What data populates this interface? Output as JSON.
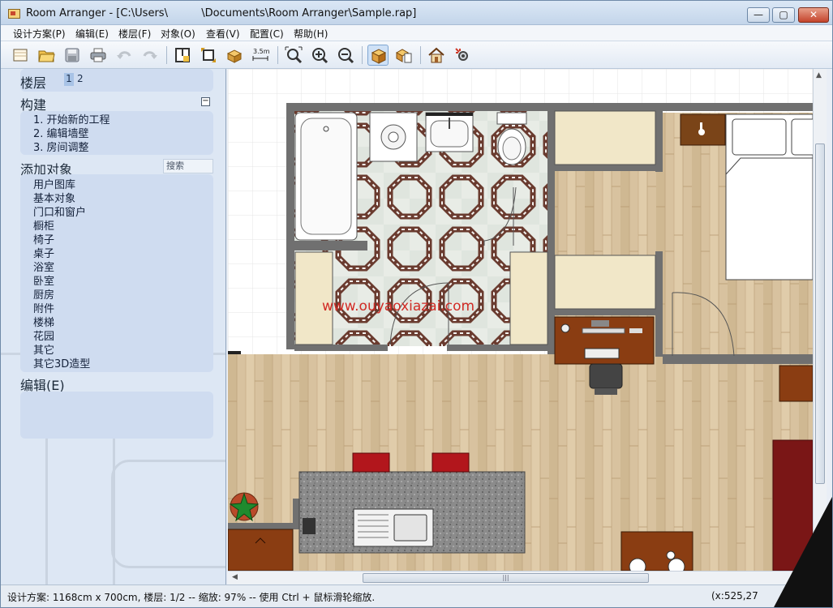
{
  "window": {
    "title": "Room Arranger - [C:\\Users\\          \\Documents\\Room Arranger\\Sample.rap]",
    "controls": {
      "minimize": "—",
      "maximize": "▢",
      "close": "✕"
    }
  },
  "menu": [
    "设计方案(P)",
    "编辑(E)",
    "楼层(F)",
    "对象(O)",
    "查看(V)",
    "配置(C)",
    "帮助(H)"
  ],
  "toolbar": {
    "icons": [
      "new-icon",
      "open-icon",
      "save-icon",
      "print-icon",
      "undo-icon",
      "redo-icon",
      "edit-walls-icon",
      "room-size-icon",
      "objects-icon",
      "measure-icon",
      "zoom-fit-icon",
      "zoom-in-icon",
      "zoom-out-icon",
      "3d-box-icon",
      "3d-view-icon",
      "house-icon",
      "settings-icon"
    ],
    "measure_label": "3.5m"
  },
  "sidebar": {
    "floors": {
      "label": "楼层",
      "items": [
        "1",
        "2"
      ],
      "selected": "1"
    },
    "construct": {
      "label": "构建",
      "collapse": "−",
      "steps": [
        "1. 开始新的工程",
        "2. 编辑墙壁",
        "3. 房间调整"
      ]
    },
    "add_objects": {
      "label": "添加对象",
      "search": "搜索",
      "categories": [
        "用户图库",
        "基本对象",
        "门口和窗户",
        "橱柜",
        "椅子",
        "桌子",
        "浴室",
        "卧室",
        "厨房",
        "附件",
        "楼梯",
        "花园",
        "其它",
        "其它3D造型"
      ]
    },
    "edit": {
      "label": "编辑(E)"
    }
  },
  "canvas": {
    "watermark": "www.ouyaoxiazai.com",
    "colors": {
      "wall": "#6e6e6e",
      "floor": "#d7c09c",
      "cabinet": "#f1e7c8",
      "desk": "#8a3d12",
      "chair_red": "#b2161c",
      "counter": "#8c8c8c"
    }
  },
  "scrollbars": {
    "grip": "|||"
  },
  "status": {
    "text": "设计方案: 1168cm x 700cm, 楼层: 1/2 -- 缩放: 97% -- 使用 Ctrl + 鼠标滑轮缩放.",
    "coords": "(x:525,27"
  }
}
